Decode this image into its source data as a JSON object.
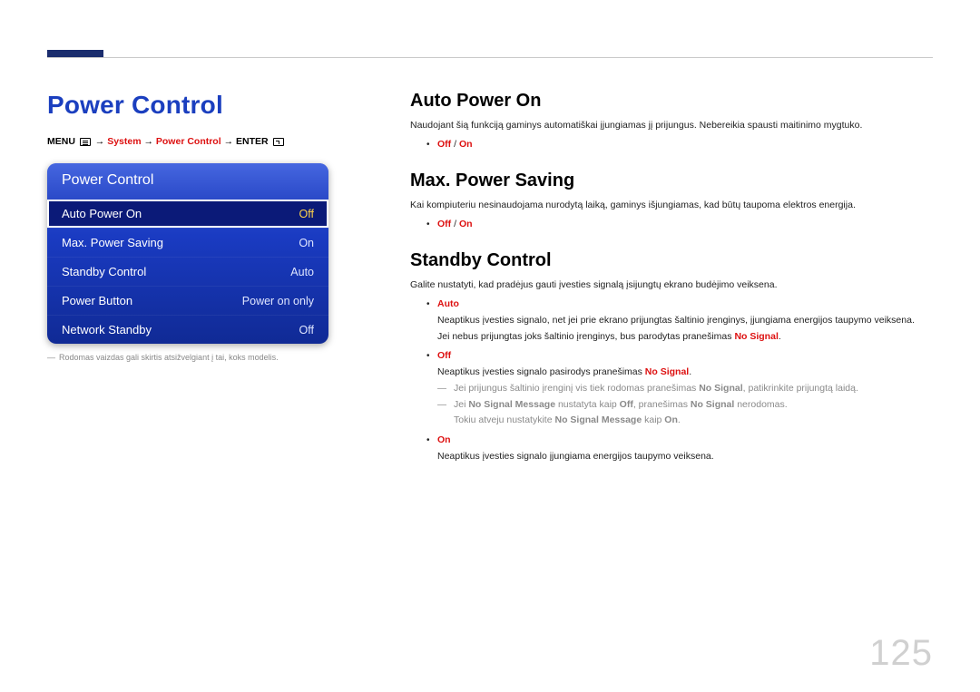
{
  "page_number": "125",
  "title": "Power Control",
  "breadcrumb": {
    "menu": "MENU",
    "arrow": "→",
    "system": "System",
    "power_control": "Power Control",
    "enter": "ENTER"
  },
  "menu_panel": {
    "header": "Power Control",
    "items": [
      {
        "label": "Auto Power On",
        "value": "Off",
        "selected": true
      },
      {
        "label": "Max. Power Saving",
        "value": "On",
        "selected": false
      },
      {
        "label": "Standby Control",
        "value": "Auto",
        "selected": false
      },
      {
        "label": "Power Button",
        "value": "Power on only",
        "selected": false
      },
      {
        "label": "Network Standby",
        "value": "Off",
        "selected": false
      }
    ]
  },
  "left_note": "Rodomas vaizdas gali skirtis atsižvelgiant į tai, koks modelis.",
  "sections": {
    "auto_power_on": {
      "heading": "Auto Power On",
      "text": "Naudojant šią funkciją gaminys automatiškai įjungiamas jį prijungus. Nebereikia spausti maitinimo mygtuko.",
      "option_off": "Off",
      "option_slash": " / ",
      "option_on": "On"
    },
    "max_power_saving": {
      "heading": "Max. Power Saving",
      "text": "Kai kompiuteriu nesinaudojama nurodytą laiką, gaminys išjungiamas, kad būtų taupoma elektros energija.",
      "option_off": "Off",
      "option_slash": " / ",
      "option_on": "On"
    },
    "standby_control": {
      "heading": "Standby Control",
      "intro": "Galite nustatyti, kad pradėjus gauti įvesties signalą įsijungtų ekrano budėjimo veiksena.",
      "auto_label": "Auto",
      "auto_line1": "Neaptikus įvesties signalo, net jei prie ekrano prijungtas šaltinio įrenginys, įjungiama energijos taupymo veiksena.",
      "auto_line2_a": "Jei nebus prijungtas joks šaltinio įrenginys, bus parodytas pranešimas ",
      "auto_line2_b": "No Signal",
      "auto_line2_c": ".",
      "off_label": "Off",
      "off_line1_a": "Neaptikus įvesties signalo pasirodys pranešimas ",
      "off_line1_b": "No Signal",
      "off_line1_c": ".",
      "off_note1_a": "Jei prijungus šaltinio įrenginį vis tiek rodomas pranešimas ",
      "off_note1_b": "No Signal",
      "off_note1_c": ", patikrinkite prijungtą laidą.",
      "off_note2_a": "Jei ",
      "off_note2_b": "No Signal Message",
      "off_note2_c": " nustatyta kaip ",
      "off_note2_d": "Off",
      "off_note2_e": ", pranešimas ",
      "off_note2_f": "No Signal",
      "off_note2_g": " nerodomas.",
      "off_note3_a": "Tokiu atveju nustatykite ",
      "off_note3_b": "No Signal Message",
      "off_note3_c": " kaip ",
      "off_note3_d": "On",
      "off_note3_e": ".",
      "on_label": "On",
      "on_line": "Neaptikus įvesties signalo įjungiama energijos taupymo veiksena."
    }
  }
}
